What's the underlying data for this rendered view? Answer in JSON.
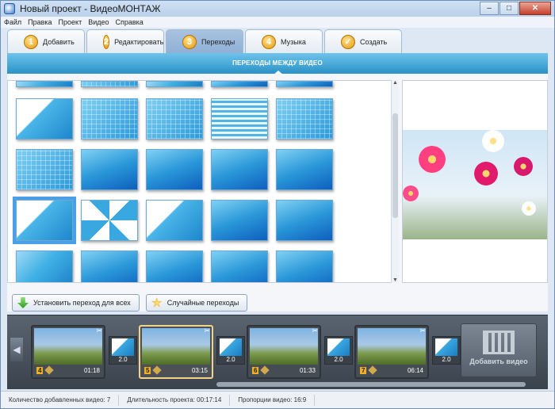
{
  "window": {
    "title": "Новый проект - ВидеоМОНТАЖ",
    "minimize": "–",
    "maximize": "□",
    "close": "✕"
  },
  "menu": [
    "Файл",
    "Правка",
    "Проект",
    "Видео",
    "Справка"
  ],
  "tabs": [
    {
      "num": "1",
      "label": "Добавить"
    },
    {
      "num": "2",
      "label": "Редактировать"
    },
    {
      "num": "3",
      "label": "Переходы"
    },
    {
      "num": "4",
      "label": "Музыка"
    },
    {
      "num": "✓",
      "label": "Создать"
    }
  ],
  "active_tab": "Переходы",
  "section": {
    "title": "ПЕРЕХОДЫ МЕЖДУ ВИДЕО"
  },
  "buttons": {
    "apply_all": "Установить переход для всех",
    "random": "Случайные переходы"
  },
  "timeline": {
    "clips": [
      {
        "num": "4",
        "time": "01:18"
      },
      {
        "num": "5",
        "time": "03:15"
      },
      {
        "num": "6",
        "time": "01:33"
      },
      {
        "num": "7",
        "time": "06:14"
      }
    ],
    "transitions": [
      "2.0",
      "2.0",
      "2.0",
      "2.0"
    ],
    "add_video": "Добавить видео",
    "nav_left": "◀"
  },
  "status": {
    "clips_count": "Количество добавленных видео: 7",
    "duration": "Длительность проекта:  00:17:14",
    "ratio": "Пропорции видео:  16:9"
  },
  "scroll": {
    "up": "▲",
    "down": "▼"
  }
}
